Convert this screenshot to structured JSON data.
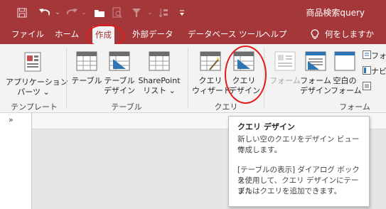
{
  "title_bar": {
    "title": "商品検索query",
    "icons": [
      "save-icon",
      "undo-icon",
      "redo-icon",
      "folder-icon",
      "print-preview-icon",
      "filter-icon",
      "sort-icon",
      "customize-qat-icon"
    ]
  },
  "menu": {
    "items": [
      "ファイル",
      "ホーム",
      "作成",
      "外部データ",
      "データベース ツール",
      "ヘルプ"
    ],
    "active": "作成",
    "search_icon": "lightbulb-icon",
    "search_label": "何をしますか"
  },
  "ribbon": {
    "groups": [
      {
        "label": "テンプレート",
        "buttons": [
          {
            "line1": "アプリケーション",
            "line2": "パーツ ⌄",
            "icon": "application-parts-icon"
          }
        ]
      },
      {
        "label": "テーブル",
        "buttons": [
          {
            "line1": "テーブル",
            "line2": "",
            "icon": "table-icon"
          },
          {
            "line1": "テーブル",
            "line2": "デザイン",
            "icon": "table-design-icon"
          },
          {
            "line1": "SharePoint",
            "line2": "リスト ⌄",
            "icon": "sharepoint-list-icon"
          }
        ]
      },
      {
        "label": "クエリ",
        "buttons": [
          {
            "line1": "クエリ",
            "line2": "ウィザード",
            "icon": "query-wizard-icon"
          },
          {
            "line1": "クエリ",
            "line2": "デザイン",
            "icon": "query-design-icon"
          }
        ]
      },
      {
        "label": "フォーム",
        "buttons": [
          {
            "line1": "フォーム",
            "line2": "",
            "icon": "form-icon"
          },
          {
            "line1": "フォーム",
            "line2": "デザイン",
            "icon": "form-design-icon"
          },
          {
            "line1": "空白の",
            "line2": "フォーム",
            "icon": "blank-form-icon"
          },
          {
            "line1": "フォ",
            "line2": "",
            "icon": "form-wizard-icon"
          },
          {
            "line1": "ナビ",
            "line2": "",
            "icon": "navigation-icon"
          },
          {
            "line1": "",
            "line2": "",
            "icon": "more-forms-icon"
          }
        ]
      }
    ]
  },
  "navigation_pane": {
    "collapse_label": "»"
  },
  "tooltip": {
    "title": "クエリ デザイン",
    "para1_line1": "新しい空のクエリをデザイン ビューで",
    "para1_line2": "作成します。",
    "para2_line1": "[テーブルの表示] ダイアログ ボックス",
    "para2_line2": "を使用して、クエリ デザインにテーブル",
    "para2_line3": "またはクエリを追加できます。"
  },
  "colors": {
    "accent": "#a4373a",
    "ribbon_bg": "#f3f3f3",
    "highlight_circle": "#e21b1b"
  }
}
